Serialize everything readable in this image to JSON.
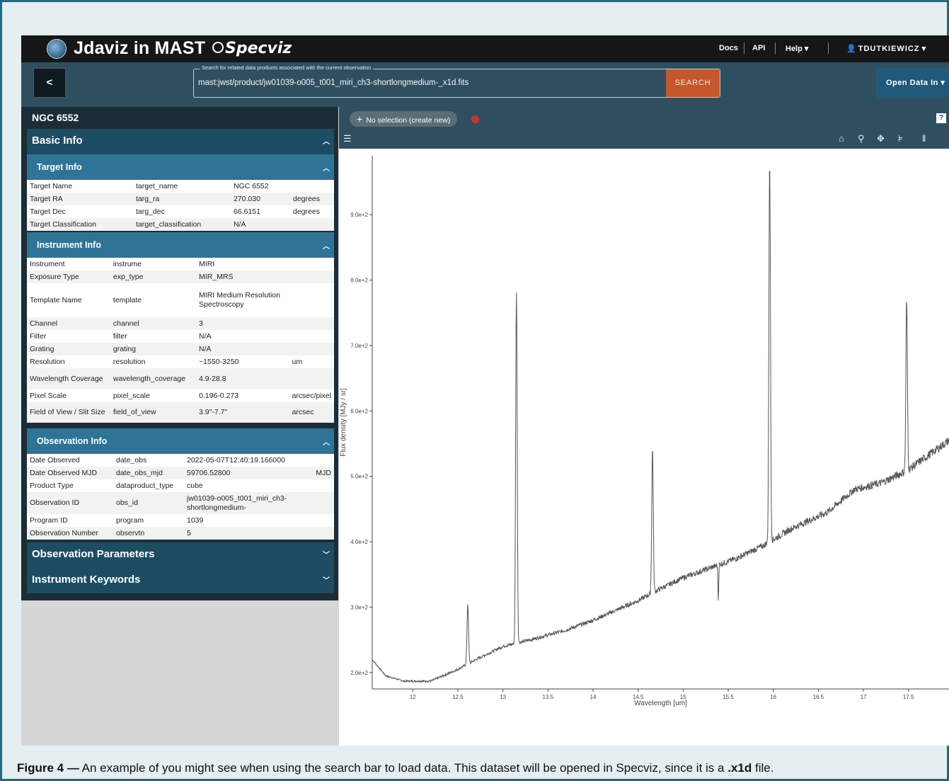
{
  "header": {
    "title": "Jdaviz in MAST",
    "brand": "Specviz",
    "nav": {
      "docs": "Docs",
      "api": "API",
      "help": "Help",
      "user": "TDUTKIEWICZ"
    }
  },
  "search": {
    "back_label": "<",
    "legend": "Search for related data products associated with the current observation",
    "value": "mast:jwst/product/jw01039-o005_t001_miri_ch3-shortlongmedium-_x1d.fits",
    "button": "SEARCH",
    "open_data": "Open Data In"
  },
  "panel": {
    "title": "NGC 6552",
    "basic_info": "Basic Info",
    "target_info": "Target Info",
    "target_rows": [
      [
        "Target Name",
        "target_name",
        "NGC 6552",
        ""
      ],
      [
        "Target RA",
        "targ_ra",
        "270.030",
        "degrees"
      ],
      [
        "Target Dec",
        "targ_dec",
        "66.6151",
        "degrees"
      ],
      [
        "Target Classification",
        "target_classification",
        "N/A",
        ""
      ]
    ],
    "instrument_info": "Instrument Info",
    "instrument_rows": [
      [
        "Instrument",
        "instrume",
        "MIRI",
        ""
      ],
      [
        "Exposure Type",
        "exp_type",
        "MIR_MRS",
        ""
      ],
      [
        "Template Name",
        "template",
        "MIRI Medium Resolution Spectroscopy",
        ""
      ],
      [
        "Channel",
        "channel",
        "3",
        ""
      ],
      [
        "Filter",
        "filter",
        "N/A",
        ""
      ],
      [
        "Grating",
        "grating",
        "N/A",
        ""
      ],
      [
        "Resolution",
        "resolution",
        "~1550-3250",
        "um"
      ],
      [
        "Wavelength Coverage",
        "wavelength_coverage",
        "4.9-28.8",
        ""
      ],
      [
        "Pixel Scale",
        "pixel_scale",
        "0.196-0.273",
        "arcsec/pixel"
      ],
      [
        "Field of View / Slit Size",
        "field_of_view",
        "3.9\"-7.7\"",
        "arcsec"
      ]
    ],
    "observation_info": "Observation Info",
    "observation_rows": [
      [
        "Date Observed",
        "date_obs",
        "2022-05-07T12:40:19.166000",
        ""
      ],
      [
        "Date Observed MJD",
        "date_obs_mjd",
        "59706.52800",
        "MJD"
      ],
      [
        "Product Type",
        "dataproduct_type",
        "cube",
        ""
      ],
      [
        "Observation ID",
        "obs_id",
        "jw01039-o005_t001_miri_ch3-shortlongmedium-",
        ""
      ],
      [
        "Program ID",
        "program",
        "1039",
        ""
      ],
      [
        "Observation Number",
        "observtn",
        "5",
        ""
      ]
    ],
    "observation_parameters": "Observation Parameters",
    "instrument_keywords": "Instrument Keywords"
  },
  "viewer": {
    "selection_label": "No selection (create new)",
    "help": "?"
  },
  "chart_data": {
    "type": "line",
    "xlabel": "Wavelength [um]",
    "ylabel": "Flux density [MJy / sr]",
    "xlim": [
      11.55,
      17.95
    ],
    "ylim": [
      175,
      990
    ],
    "xticks": [
      "12",
      "12.5",
      "13",
      "13.5",
      "14",
      "14.5",
      "15",
      "15.5",
      "16",
      "16.5",
      "17",
      "17.5"
    ],
    "yticks": [
      "2.0e+2",
      "3.0e+2",
      "4.0e+2",
      "5.0e+2",
      "6.0e+2",
      "7.0e+2",
      "8.0e+2",
      "9.0e+2"
    ],
    "continuum": [
      [
        11.55,
        220
      ],
      [
        11.7,
        195
      ],
      [
        11.9,
        187
      ],
      [
        12.2,
        187
      ],
      [
        12.5,
        205
      ],
      [
        12.7,
        220
      ],
      [
        13.0,
        240
      ],
      [
        13.3,
        250
      ],
      [
        13.7,
        265
      ],
      [
        14.0,
        280
      ],
      [
        14.5,
        310
      ],
      [
        14.7,
        325
      ],
      [
        15.0,
        345
      ],
      [
        15.3,
        360
      ],
      [
        15.6,
        375
      ],
      [
        15.9,
        395
      ],
      [
        16.2,
        420
      ],
      [
        16.6,
        445
      ],
      [
        16.9,
        480
      ],
      [
        17.2,
        490
      ],
      [
        17.5,
        510
      ],
      [
        17.95,
        555
      ]
    ],
    "peaks": [
      {
        "x": 12.61,
        "y": 305
      },
      {
        "x": 13.15,
        "y": 783
      },
      {
        "x": 14.66,
        "y": 543
      },
      {
        "x": 15.96,
        "y": 985
      },
      {
        "x": 17.48,
        "y": 770
      }
    ],
    "dips": [
      {
        "x": 15.39,
        "y": 310
      }
    ],
    "line_color": "#555555"
  },
  "caption": {
    "label": "Figure 4 —",
    "text1": "An example of you might see when using the search bar to load data. This dataset will be opened in Specviz, since it is a",
    "ext": ".x1d",
    "text2": "file."
  }
}
